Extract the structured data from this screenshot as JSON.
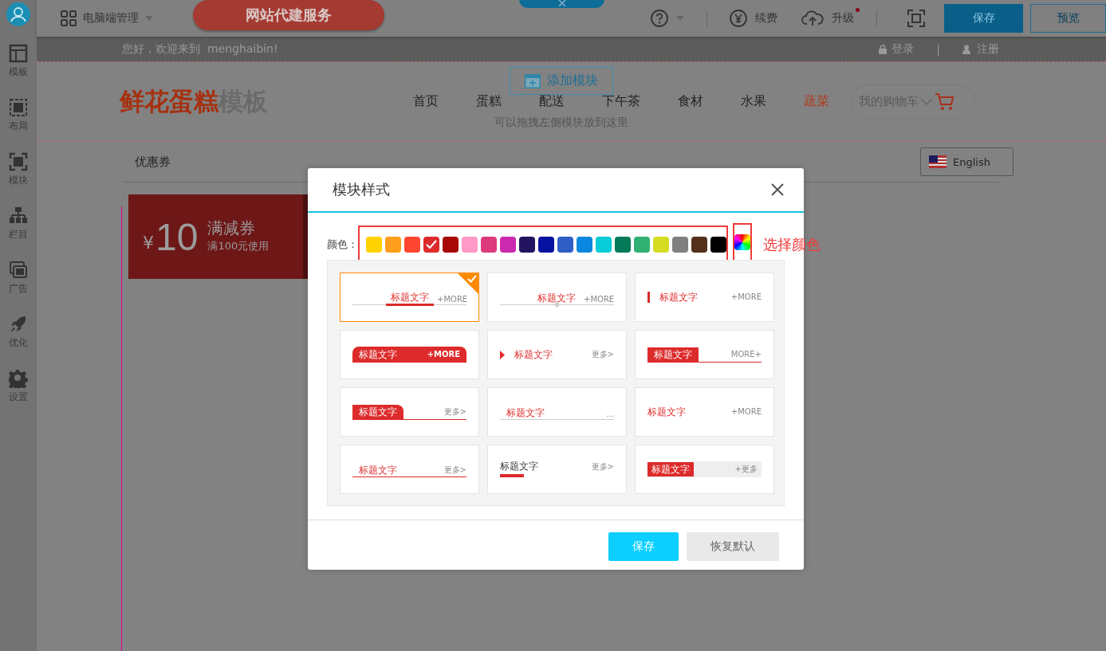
{
  "sidebar": {
    "items": [
      {
        "label": "模板"
      },
      {
        "label": "布局"
      },
      {
        "label": "模块"
      },
      {
        "label": "栏目"
      },
      {
        "label": "广告"
      },
      {
        "label": "优化"
      },
      {
        "label": "设置"
      }
    ]
  },
  "topbar": {
    "site_menu": "电脑端管理",
    "banner": "网站代建服务",
    "renew": "续费",
    "upgrade": "升级",
    "upgrade_notice": true,
    "save": "保存",
    "preview": "预览"
  },
  "page": {
    "welcome": "您好，欢迎来到  menghaibin!",
    "login": "登录",
    "separator": "|",
    "register": "注册",
    "logo": {
      "main": "鲜花蛋糕",
      "suffix": "模板"
    },
    "nav": [
      {
        "label": "首页",
        "selected": false
      },
      {
        "label": "蛋糕",
        "selected": false
      },
      {
        "label": "配送",
        "selected": false
      },
      {
        "label": "下午茶",
        "selected": false
      },
      {
        "label": "食材",
        "selected": false
      },
      {
        "label": "水果",
        "selected": false
      },
      {
        "label": "蔬菜",
        "selected": true
      }
    ],
    "cart": "我的购物车",
    "add_module": "添加模块",
    "drop_hint": "可以拖拽左侧模块放到这里",
    "section_tab": "优惠券",
    "language": "English",
    "coupon": {
      "currency": "¥",
      "amount": "10",
      "title": "满减券",
      "condition": "满100元使用"
    }
  },
  "dialog": {
    "title": "模块样式",
    "color_label": "颜色：",
    "custom_color_hint": "选择颜色",
    "swatches": [
      {
        "color": "#ffd200",
        "selected": false
      },
      {
        "color": "#ff9f1c",
        "selected": false
      },
      {
        "color": "#ff4630",
        "selected": false
      },
      {
        "color": "#dd2a2a",
        "selected": true
      },
      {
        "color": "#a80808",
        "selected": false
      },
      {
        "color": "#ff99c6",
        "selected": false
      },
      {
        "color": "#dc3a7c",
        "selected": false
      },
      {
        "color": "#cc2aae",
        "selected": false
      },
      {
        "color": "#221460",
        "selected": false
      },
      {
        "color": "#0612a0",
        "selected": false
      },
      {
        "color": "#2f5ec6",
        "selected": false
      },
      {
        "color": "#0a88e0",
        "selected": false
      },
      {
        "color": "#08ccd8",
        "selected": false
      },
      {
        "color": "#047a58",
        "selected": false
      },
      {
        "color": "#30b072",
        "selected": false
      },
      {
        "color": "#d6dc24",
        "selected": false
      },
      {
        "color": "#7f7f7f",
        "selected": false
      },
      {
        "color": "#54301a",
        "selected": false
      },
      {
        "color": "#000000",
        "selected": false
      }
    ],
    "styles": [
      {
        "kind": "center-line",
        "title": "标题文字",
        "more": "+MORE",
        "selected": true
      },
      {
        "kind": "diamond-line",
        "title": "标题文字",
        "more": "+MORE",
        "selected": false
      },
      {
        "kind": "side-bar",
        "title": "标题文字",
        "more": "+MORE",
        "selected": false
      },
      {
        "kind": "pill",
        "title": "标题文字",
        "more": "+MORE",
        "selected": false
      },
      {
        "kind": "triangle",
        "title": "标题文字",
        "more": "更多>",
        "selected": false
      },
      {
        "kind": "tab-line",
        "title": "标题文字",
        "more": "MORE+",
        "selected": false
      },
      {
        "kind": "rounded-tab",
        "title": "标题文字",
        "more": "更多>",
        "selected": false
      },
      {
        "kind": "dots",
        "title": "标题文字",
        "more": "...",
        "selected": false
      },
      {
        "kind": "plain",
        "title": "标题文字",
        "more": "+MORE",
        "selected": false
      },
      {
        "kind": "red-line",
        "title": "标题文字",
        "more": "更多>",
        "selected": false
      },
      {
        "kind": "short-bar",
        "title": "标题文字",
        "more": "更多>",
        "selected": false
      },
      {
        "kind": "gray-bar",
        "title": "标题文字",
        "more": "+更多",
        "selected": false
      }
    ],
    "buttons": {
      "save": "保存",
      "reset": "恢复默认"
    }
  }
}
